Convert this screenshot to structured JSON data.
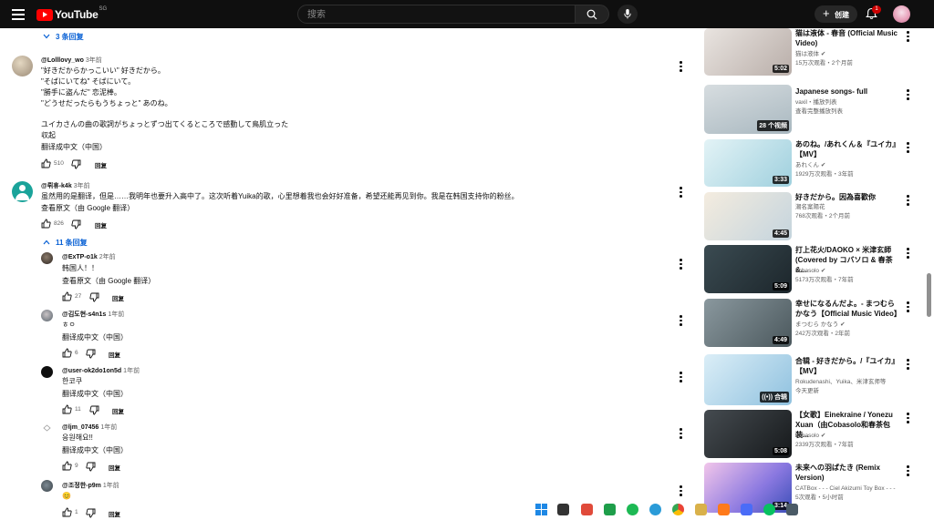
{
  "topbar": {
    "logo_text": "YouTube",
    "region": "SG",
    "search_placeholder": "搜索",
    "create_label": "创建",
    "notification_count": "1"
  },
  "comments": [
    {
      "id": "c1",
      "author": "@Lolllovy_wo",
      "time": "3年前",
      "lines": [
        "\"好きだからかっこいい\" 好きだから。",
        "\"そばにいてね\" そばにいて。",
        "\"勝手に盗んだ\" 恋泥棒。",
        "\"どうせだったらもうちょっと\" あのね。",
        "",
        "ユイカさんの曲の歌詞がちょっとずつ出てくるところで感動して鳥肌立った",
        "収起"
      ],
      "translate": "翻译成中文（中国）",
      "likes": "510",
      "reply": "回复"
    },
    {
      "id": "c2",
      "author": "@뤼휴-k4k",
      "time": "3年前",
      "text": "虽然用的是翻译，但是……我明年也要升入高中了。这次听着Yuika的歌，心里想着我也会好好准备，希望还能再见到你。我是在韩国支持你的粉丝。",
      "translate": "查看原文（由 Google 翻译）",
      "likes": "826",
      "reply": "回复",
      "replies_toggle": "11 条回复"
    },
    {
      "id": "r1",
      "author": "@ExTP-o1k",
      "time": "2年前",
      "text": "韩国人！！",
      "translate": "查看原文（由 Google 翻译）",
      "likes": "27",
      "reply": "回复"
    },
    {
      "id": "r2",
      "author": "@김도현-s4n1s",
      "time": "1年前",
      "text": "ㅎㅇ",
      "translate": "翻译成中文（中国）",
      "likes": "6",
      "reply": "回复"
    },
    {
      "id": "r3",
      "author": "@user-ok2do1on5d",
      "time": "1年前",
      "text": "한코쿠",
      "translate": "翻译成中文（中国）",
      "likes": "11",
      "reply": "回复"
    },
    {
      "id": "r4",
      "author": "@ljm_07456",
      "time": "1年前",
      "text": "응원해요!!",
      "translate": "翻译成中文（中国）",
      "likes": "9",
      "reply": "回复"
    },
    {
      "id": "r5",
      "author": "@조정한-p9m",
      "time": "1年前",
      "text": "😊",
      "likes": "1",
      "reply": "回复"
    }
  ],
  "top_replies_toggle": "3 条回复",
  "recs": [
    {
      "title": "猫は液体 - 春音 (Official Music Video)",
      "channel": "猫は液体",
      "stats": "15万次观看・2个月前",
      "duration": "5:02",
      "verified": true,
      "thumb_color": "#d9d2cf"
    },
    {
      "title": "Japanese songs- full",
      "channel": "vaxil・播放列表",
      "stats": "查看完整播放列表",
      "duration": "28 个视频",
      "playlist": true,
      "thumb_color": "#bfc9cf"
    },
    {
      "title": "あのね。/あれくん＆『ユイカ』【MV】",
      "channel": "あれくん",
      "stats": "1929万次观看・3年前",
      "duration": "3:33",
      "verified": true,
      "thumb_color": "#cfe9ef"
    },
    {
      "title": "好きだから。因為喜歡你",
      "channel": "潮名案陽花",
      "stats": "768次观看・2个月前",
      "duration": "4:45",
      "thumb_color": "#e9dcc9"
    },
    {
      "title": "打上花火/DAOKO × 米津玄師 (Covered by コバソロ & 春茶 &...",
      "channel": "kobasolo",
      "stats": "5173万次观看・7年前",
      "duration": "5:09",
      "verified": true,
      "thumb_color": "#2a3a40"
    },
    {
      "title": "幸せになるんだよ。- まつむら かなう【Official Music Video】",
      "channel": "まつむら かなう",
      "stats": "242万次观看・2年前",
      "duration": "4:49",
      "verified": true,
      "thumb_color": "#6b7a80"
    },
    {
      "title": "合辑 - 好きだから。/『ユイカ』【MV】",
      "channel": "Rokudenashi、Yuika、米津玄师等",
      "stats": "今天更新",
      "duration": "合辑",
      "mix": true,
      "thumb_color": "#bcd9ea"
    },
    {
      "title": "【女歌】Einekraine / Yonezu Xuan（由Cobasolo和春茶包装...",
      "channel": "kobasolo",
      "stats": "2339万次观看・7年前",
      "duration": "5:08",
      "verified": true,
      "thumb_color": "#2b2f33"
    },
    {
      "title": "未来への羽ばたき (Remix Version)",
      "channel": "CATBox - - - Ciel Akizumi Toy Box - - -",
      "stats": "5次观看・5小时前",
      "duration": "3:14",
      "thumb_color": "#7a6bd4"
    }
  ],
  "icons": {
    "menu": "menu-icon",
    "search": "search-icon",
    "mic": "mic-icon",
    "bell": "bell-icon",
    "like": "thumb-up-icon",
    "dislike": "thumb-down-icon",
    "more": "more-vert-icon",
    "verified": "verified-icon",
    "chevron": "chevron-down-icon"
  },
  "colors": {
    "accent_blue": "#065fd4",
    "brand_red": "#ff0000",
    "topbar_bg": "#0f0f0f"
  }
}
